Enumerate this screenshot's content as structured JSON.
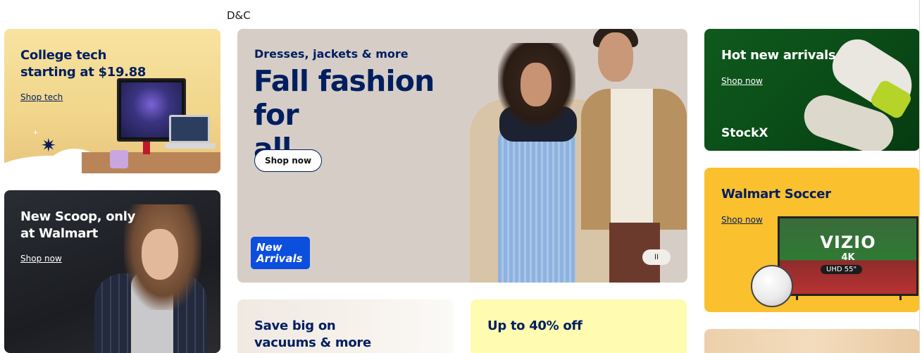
{
  "top_label": "D&C",
  "college_tech": {
    "title_line1": "College tech",
    "title_line2": "starting at $19.88",
    "link": "Shop tech"
  },
  "new_scoop": {
    "title_line1": "New Scoop, only",
    "title_line2": "at Walmart",
    "link": "Shop now"
  },
  "hero": {
    "subtitle": "Dresses, jackets & more",
    "title_line1": "Fall fashion for",
    "title_line2": "all",
    "button": "Shop now",
    "badge_line1": "New",
    "badge_line2": "Arrivals",
    "pause_icon": "pause-icon",
    "pause_glyph": "II"
  },
  "vacuums": {
    "title_line1": "Save big on",
    "title_line2": "vacuums & more"
  },
  "discount": {
    "title": "Up to 40% off"
  },
  "hot_arrivals": {
    "title": "Hot new arrivals",
    "link": "Shop now",
    "brand": "StockX"
  },
  "soccer": {
    "title": "Walmart Soccer",
    "link": "Shop now",
    "tv_brand": "VIZIO",
    "tv_res": "4K",
    "tv_size": "UHD 55\""
  },
  "colors": {
    "brand_blue": "#001e60",
    "badge_blue": "#0c4ede",
    "soccer_yellow": "#fbc02d",
    "hot_green": "#0f5a1e",
    "discount_yellow": "#fffbb0"
  }
}
